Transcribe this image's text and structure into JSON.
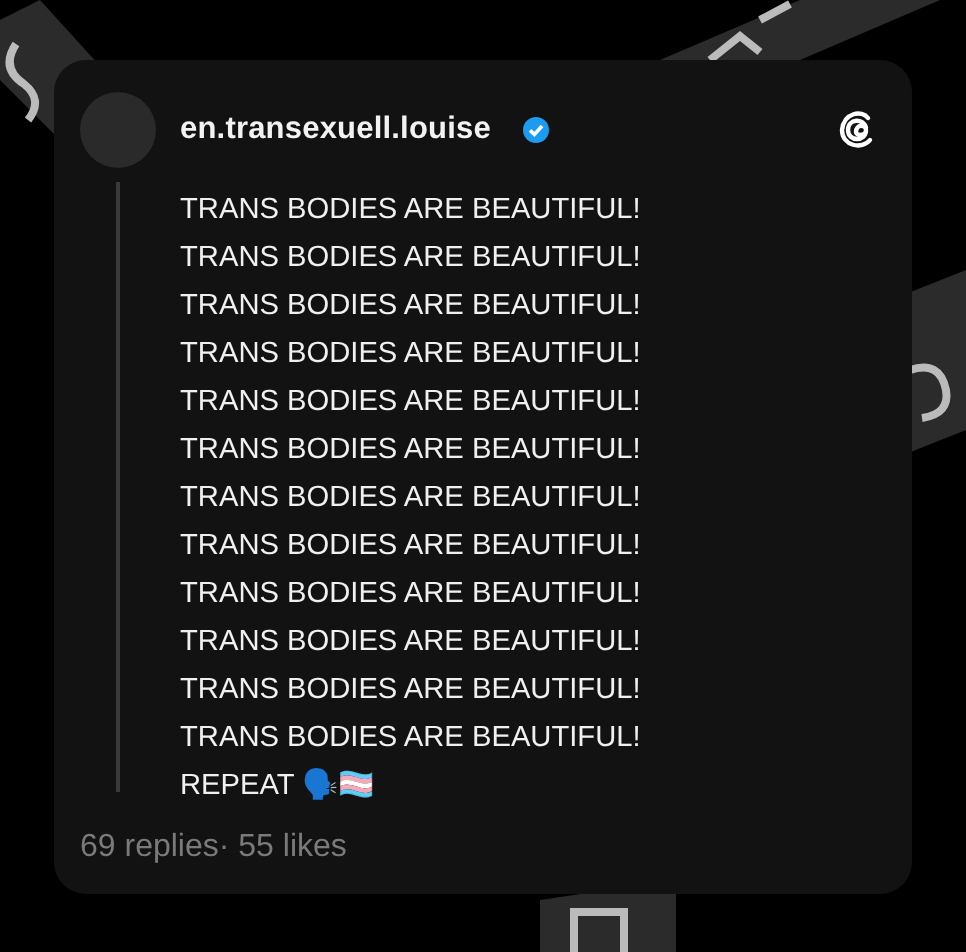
{
  "post": {
    "author": {
      "username": "en.transexuell.louise",
      "verified": true
    },
    "lines": [
      "TRANS BODIES ARE BEAUTIFUL!",
      "TRANS BODIES ARE BEAUTIFUL!",
      "TRANS BODIES ARE BEAUTIFUL!",
      "TRANS BODIES ARE BEAUTIFUL!",
      "TRANS BODIES ARE BEAUTIFUL!",
      "TRANS BODIES ARE BEAUTIFUL!",
      "TRANS BODIES ARE BEAUTIFUL!",
      "TRANS BODIES ARE BEAUTIFUL!",
      "TRANS BODIES ARE BEAUTIFUL!",
      "TRANS BODIES ARE BEAUTIFUL!",
      "TRANS BODIES ARE BEAUTIFUL!",
      "TRANS BODIES ARE BEAUTIFUL!",
      "REPEAT 🗣️🏳️‍⚧️"
    ],
    "stats": "69 replies· 55 likes"
  }
}
